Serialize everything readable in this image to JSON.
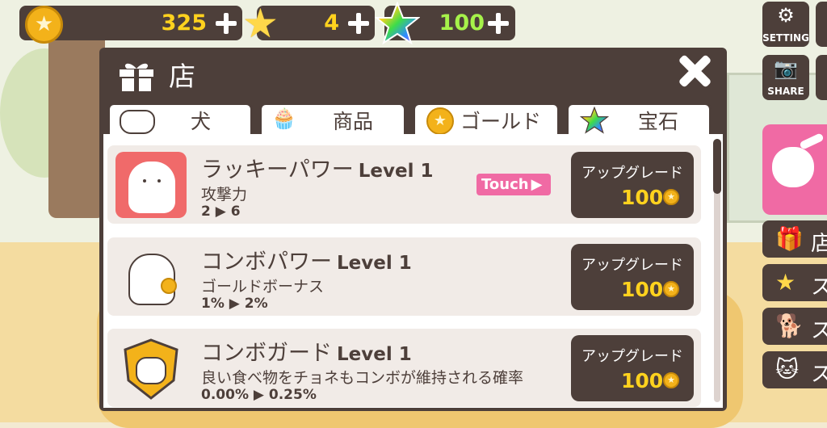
{
  "hud": {
    "coins": "325",
    "stars": "4",
    "gems": "100"
  },
  "side": {
    "setting_label": "SETTING",
    "share_label": "SHARE",
    "list_chars": [
      "店",
      "ス",
      "ス",
      "ス"
    ]
  },
  "dialog": {
    "title": "店",
    "tabs": [
      {
        "label": "犬",
        "icon": "cat-face-icon"
      },
      {
        "label": "商品",
        "icon": "cake-icon"
      },
      {
        "label": "ゴールド",
        "icon": "gold-coin-icon"
      },
      {
        "label": "宝石",
        "icon": "rainbow-star-icon"
      }
    ],
    "items": [
      {
        "name": "ラッキーパワー",
        "level": "Level 1",
        "desc": "攻撃力",
        "values": "2 ▶ 6",
        "button_label": "アップグレード",
        "price": "100",
        "icon": "lucky-cat-icon"
      },
      {
        "name": "コンボパワー",
        "level": "Level 1",
        "desc": "ゴールドボーナス",
        "values": "1% ▶ 2%",
        "button_label": "アップグレード",
        "price": "100",
        "icon": "coin-cat-icon"
      },
      {
        "name": "コンボガード",
        "level": "Level 1",
        "desc": "良い食べ物をチョネもコンボが維持される確率",
        "values": "0.00% ▶ 0.25%",
        "button_label": "アップグレード",
        "price": "100",
        "icon": "shield-cat-icon"
      }
    ],
    "touch_label": "Touch",
    "scroll_position": 0.0
  },
  "colors": {
    "panel": "#4d3f3a",
    "accent_pink": "#f06aa4",
    "gold": "#ffd21e",
    "coins_text": "#ffd21e",
    "stars_text": "#ffd21e",
    "gems_text": "#a6f24a"
  }
}
